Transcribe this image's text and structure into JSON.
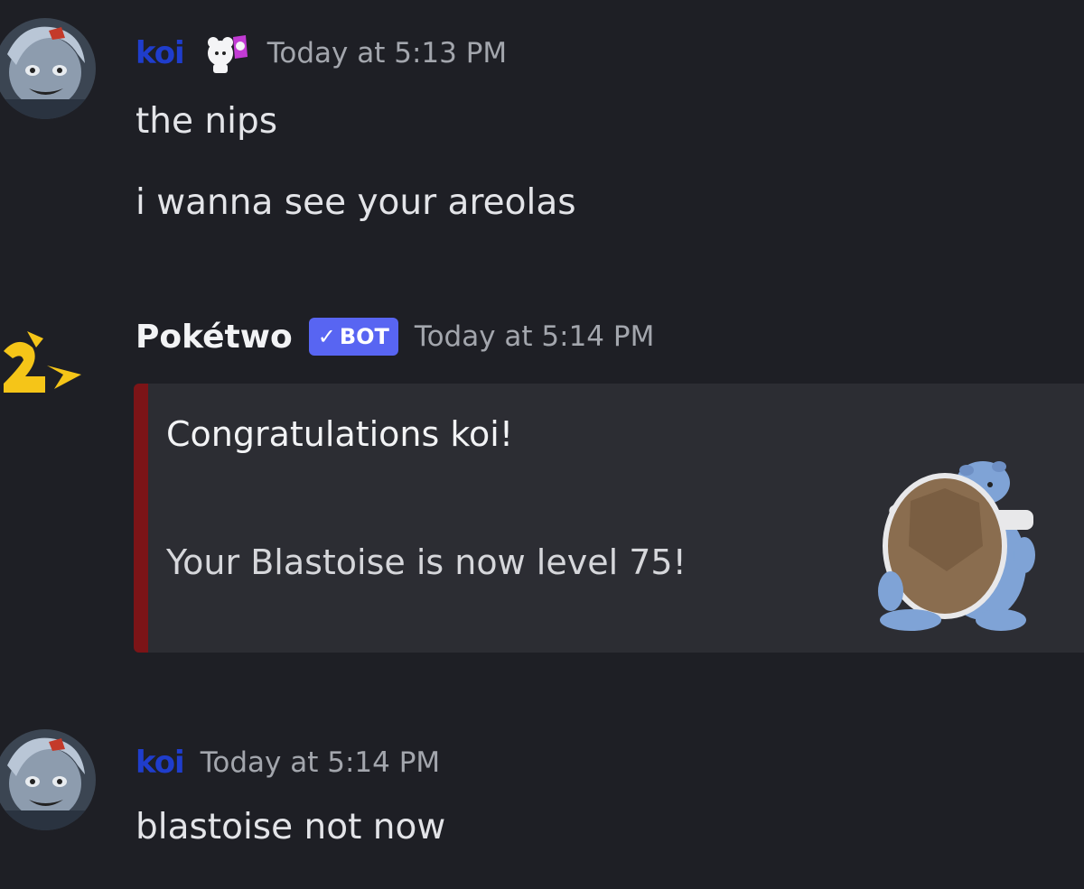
{
  "messages": [
    {
      "username": "koi",
      "timestamp": "Today at 5:13 PM",
      "lines": [
        "the nips",
        "i wanna see your areolas"
      ]
    },
    {
      "username": "Pokétwo",
      "tag_check": "✓",
      "tag": "BOT",
      "timestamp": "Today at 5:14 PM",
      "embed": {
        "title": "Congratulations koi!",
        "description": "Your Blastoise is now level 75!",
        "accent_color": "#7c1417"
      }
    },
    {
      "username": "koi",
      "timestamp": "Today at 5:14 PM",
      "lines": [
        "blastoise not now"
      ]
    }
  ],
  "colors": {
    "background": "#1e1f25",
    "username_koi": "#1f3dcc",
    "bot_tag": "#5865f2",
    "timestamp": "#a3a6ad"
  },
  "icons": [
    "koi-avatar",
    "poketwo-avatar",
    "sticker-icon",
    "blastoise-thumbnail"
  ]
}
